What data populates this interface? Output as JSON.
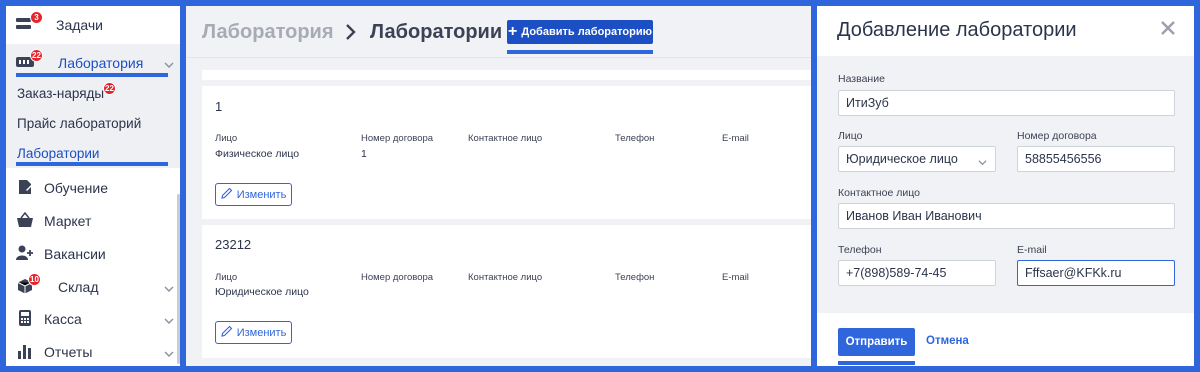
{
  "colors": {
    "frame": "#2f66dc",
    "accent": "#2f66dc",
    "primary_button": "#1c4fc3",
    "badge": "#e3262d"
  },
  "sidebar": {
    "tasks": {
      "label": "Задачи",
      "badge": "3",
      "icon": "tasks-icon"
    },
    "lab": {
      "label": "Лаборатория",
      "badge": "22",
      "icon": "lab-icon"
    },
    "sub_items": [
      {
        "label": "Заказ-наряды",
        "badge": "22"
      },
      {
        "label": "Прайс лабораторий"
      },
      {
        "label": "Лаборатории",
        "active": true
      }
    ],
    "items": [
      {
        "label": "Обучение",
        "icon": "education-icon"
      },
      {
        "label": "Маркет",
        "icon": "basket-icon"
      },
      {
        "label": "Вакансии",
        "icon": "add-user-icon"
      },
      {
        "label": "Склад",
        "icon": "box-icon",
        "badge": "10"
      },
      {
        "label": "Касса",
        "icon": "calculator-icon"
      },
      {
        "label": "Отчеты",
        "icon": "bar-chart-icon"
      }
    ]
  },
  "header": {
    "breadcrumb_parent": "Лаборатория",
    "breadcrumb_current": "Лаборатории",
    "add_button": "Добавить лабораторию"
  },
  "labs": [
    {
      "name": "1",
      "columns": [
        "Лицо",
        "Номер договора",
        "Контактное лицо",
        "Телефон",
        "E-mail"
      ],
      "values": [
        "Физическое лицо",
        "1",
        "",
        "",
        ""
      ],
      "edit_label": "Изменить"
    },
    {
      "name": "23212",
      "columns": [
        "Лицо",
        "Номер договора",
        "Контактное лицо",
        "Телефон",
        "E-mail"
      ],
      "values": [
        "Юридическое лицо",
        "",
        "",
        "",
        ""
      ],
      "edit_label": "Изменить"
    }
  ],
  "modal": {
    "title": "Добавление лаборатории",
    "fields": {
      "name": {
        "label": "Название",
        "value": "ИтиЗуб"
      },
      "entity": {
        "label": "Лицо",
        "value": "Юридическое лицо"
      },
      "contract": {
        "label": "Номер договора",
        "value": "58855456556"
      },
      "contact": {
        "label": "Контактное лицо",
        "value": "Иванов Иван Иванович"
      },
      "phone": {
        "label": "Телефон",
        "value": "+7(898)589-74-45"
      },
      "email": {
        "label": "E-mail",
        "value": "Fffsaer@KFKk.ru"
      }
    },
    "submit": "Отправить",
    "cancel": "Отмена"
  }
}
